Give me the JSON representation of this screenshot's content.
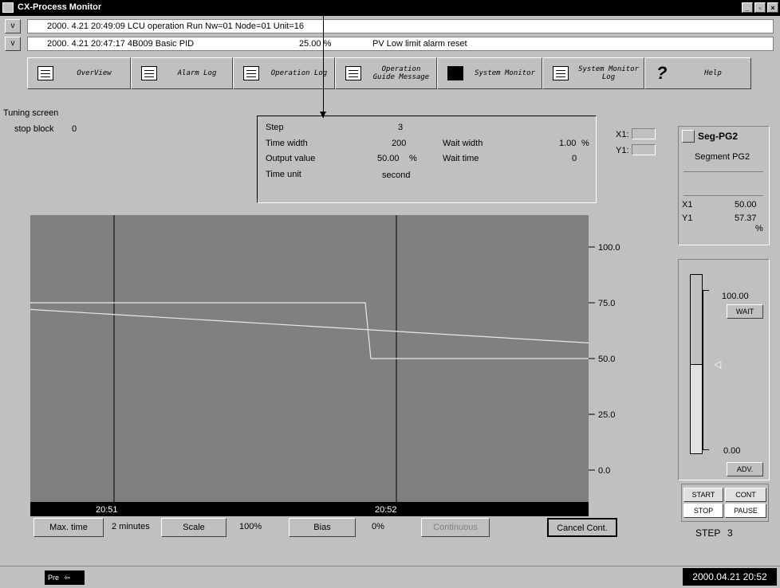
{
  "window": {
    "title": "CX-Process Monitor",
    "minimize": "_",
    "maximize": "▫",
    "close": "×"
  },
  "messages": [
    {
      "toggle": "v",
      "text": "2000. 4.21 20:49:09 LCU operation Run  Nw=01 Node=01 Unit=16"
    },
    {
      "toggle": "v",
      "text": "2000. 4.21 20:47:17 4B009   Basic PID",
      "value": "25.00 %",
      "note": "PV Low limit alarm reset"
    }
  ],
  "toolbar": [
    {
      "label": "OverView",
      "icon": "overview-icon"
    },
    {
      "label": "Alarm Log",
      "icon": "alarm-log-icon"
    },
    {
      "label": "Operation Log",
      "icon": "operation-log-icon"
    },
    {
      "label": "Operation Guide Message",
      "icon": "operation-guide-icon"
    },
    {
      "label": "System Monitor",
      "icon": "system-monitor-icon"
    },
    {
      "label": "System Monitor Log",
      "icon": "system-monitor-log-icon"
    },
    {
      "label": "Help",
      "icon": "help-icon"
    }
  ],
  "screen": {
    "title": "Tuning screen",
    "stop_block_label": "stop block",
    "stop_block_value": "0"
  },
  "step_info": {
    "step_label": "Step",
    "step_value": "3",
    "time_width_label": "Time width",
    "time_width_value": "200",
    "wait_width_label": "Wait width",
    "wait_width_value": "1.00",
    "wait_width_unit": "%",
    "output_value_label": "Output value",
    "output_value_value": "50.00",
    "output_value_unit": "%",
    "wait_time_label": "Wait time",
    "wait_time_value": "0",
    "time_unit_label": "Time unit",
    "time_unit_value": "second"
  },
  "cursor": {
    "x1_label": "X1:",
    "y1_label": "Y1:"
  },
  "segment": {
    "name": "Seg-PG2",
    "description": "Segment PG2",
    "x1_label": "X1",
    "x1_value": "50.00",
    "y1_label": "Y1",
    "y1_value": "57.37",
    "y1_unit": "%",
    "bar_max": "100.00",
    "bar_min": "0.00",
    "bar_level": 0.5,
    "wait_label": "WAIT",
    "adv_label": "ADV.",
    "start_label": "START",
    "cont_label": "CONT",
    "stop_label": "STOP",
    "pause_label": "PAUSE",
    "step_label": "STEP",
    "step_value": "3"
  },
  "controls": {
    "max_time_label": "Max. time",
    "max_time_value": "2 minutes",
    "scale_label": "Scale",
    "scale_value": "100%",
    "bias_label": "Bias",
    "bias_value": "0%",
    "continuous_label": "Continuous",
    "cancel_cont_label": "Cancel Cont."
  },
  "status": {
    "pre_label": "Pre",
    "clock": "2000.04.21 20:52"
  },
  "colors": {
    "plot_bg": "#808080",
    "trace": "#e8e8e8",
    "axis_bar": "#000000",
    "window_bg": "#c0c0c0"
  },
  "chart_data": {
    "type": "line",
    "ylim": [
      0,
      100
    ],
    "y_ticks": [
      "100.0",
      "75.0",
      "50.0",
      "25.0",
      "0.0"
    ],
    "x_ticks": [
      "20:51",
      "20:52"
    ],
    "x_range_minutes": [
      0,
      2
    ],
    "series": [
      {
        "x": [
          0,
          1.2,
          1.22,
          2
        ],
        "values": [
          75,
          75,
          50,
          50
        ]
      },
      {
        "x": [
          0,
          2
        ],
        "values": [
          72,
          57
        ]
      }
    ]
  }
}
